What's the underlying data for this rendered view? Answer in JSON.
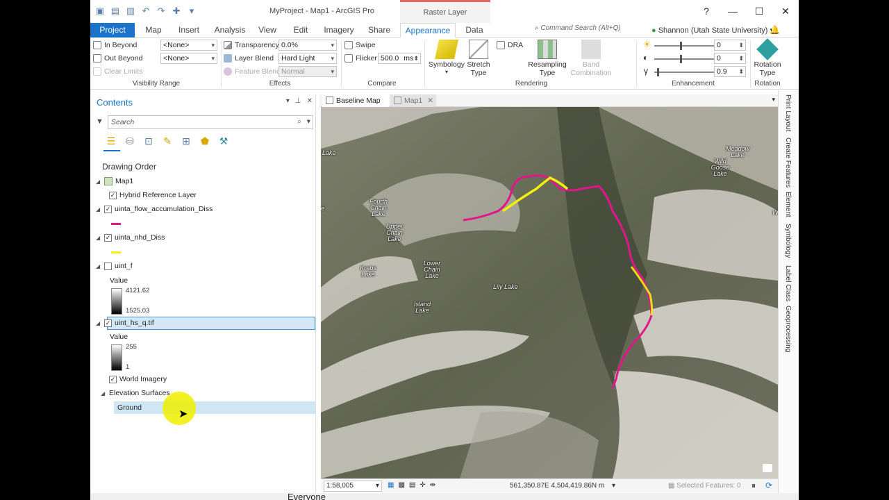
{
  "title": {
    "app_title": "MyProject - Map1 - ArcGIS Pro",
    "context_header": "Raster Layer",
    "help": "?",
    "minimize": "—",
    "maximize": "☐",
    "close": "✕"
  },
  "tabs": {
    "project": "Project",
    "map": "Map",
    "insert": "Insert",
    "analysis": "Analysis",
    "view": "View",
    "edit": "Edit",
    "imagery": "Imagery",
    "share": "Share",
    "appearance": "Appearance",
    "data": "Data",
    "command_search_placeholder": "Command Search (Alt+Q)",
    "user": "Shannon (Utah State University) ▾"
  },
  "ribbon": {
    "visibility": {
      "in_beyond": "In Beyond",
      "out_beyond": "Out Beyond",
      "clear_limits": "Clear Limits",
      "in_value": "<None>",
      "out_value": "<None>",
      "label": "Visibility Range"
    },
    "effects": {
      "transparency": "Transparency",
      "transparency_value": "0.0%",
      "layer_blend": "Layer Blend",
      "layer_blend_value": "Hard Light",
      "feature_blend": "Feature Blend",
      "feature_blend_value": "Normal",
      "label": "Effects"
    },
    "compare": {
      "swipe": "Swipe",
      "flicker": "Flicker",
      "flicker_value": "500.0",
      "flicker_unit": "ms",
      "label": "Compare"
    },
    "rendering": {
      "symbology": "Symbology",
      "stretch_type_1": "Stretch",
      "stretch_type_2": "Type",
      "dra": "DRA",
      "resampling_1": "Resampling",
      "resampling_2": "Type",
      "band_1": "Band",
      "band_2": "Combination",
      "label": "Rendering"
    },
    "enhancement": {
      "brightness": "0",
      "brightness_level": 0.45,
      "contrast": "0",
      "contrast_level": 0.45,
      "gamma": "0.9",
      "gamma_level": 0.05,
      "label": "Enhancement"
    },
    "rotation": {
      "rotation_1": "Rotation",
      "rotation_2": "Type",
      "label": "Rotation"
    }
  },
  "contents": {
    "title": "Contents",
    "search_placeholder": "Search",
    "drawing_order": "Drawing Order",
    "map": "Map1",
    "layers": {
      "hybrid": "Hybrid Reference Layer",
      "flow": "uinta_flow_accumulation_Diss",
      "nhd": "uinta_nhd_Diss",
      "uint_f": "uint_f",
      "uint_f_value_label": "Value",
      "uint_f_high": "4121.62",
      "uint_f_low": "1525.03",
      "hs": "uint_hs_q.tif",
      "hs_value_label": "Value",
      "hs_high": "255",
      "hs_low": "1",
      "world_imagery": "World Imagery",
      "elevation": "Elevation Surfaces",
      "ground": "Ground"
    },
    "colors": {
      "flow_line": "#e0168a",
      "nhd_line": "#f4f00a"
    }
  },
  "map_view": {
    "tab_baseline": "Baseline Map",
    "tab_map1": "Map1",
    "labels": {
      "lake_left": "Lake",
      "meadow": "Meadow Lake",
      "wild_goose": "Wild Goose Lake",
      "fourth_chain": "Fourth Chain Lake",
      "upper_chain": "Upper Chain Lake",
      "lower_chain": "Lower Chain Lake",
      "krebs": "Krebs Lake",
      "lily": "Lily Lake",
      "island": "Island Lake",
      "e_edge": "e",
      "w_edge": "W"
    },
    "status": {
      "scale": "1:58,005",
      "coords": "561,350.87E 4,504,419.86N m",
      "selected": "Selected Features: 0"
    }
  },
  "side_panels": [
    "Print Layout",
    "Create Features",
    "Element",
    "Symbology",
    "Label Class",
    "Geoprocessing"
  ],
  "taskbar_text": "Everyone"
}
